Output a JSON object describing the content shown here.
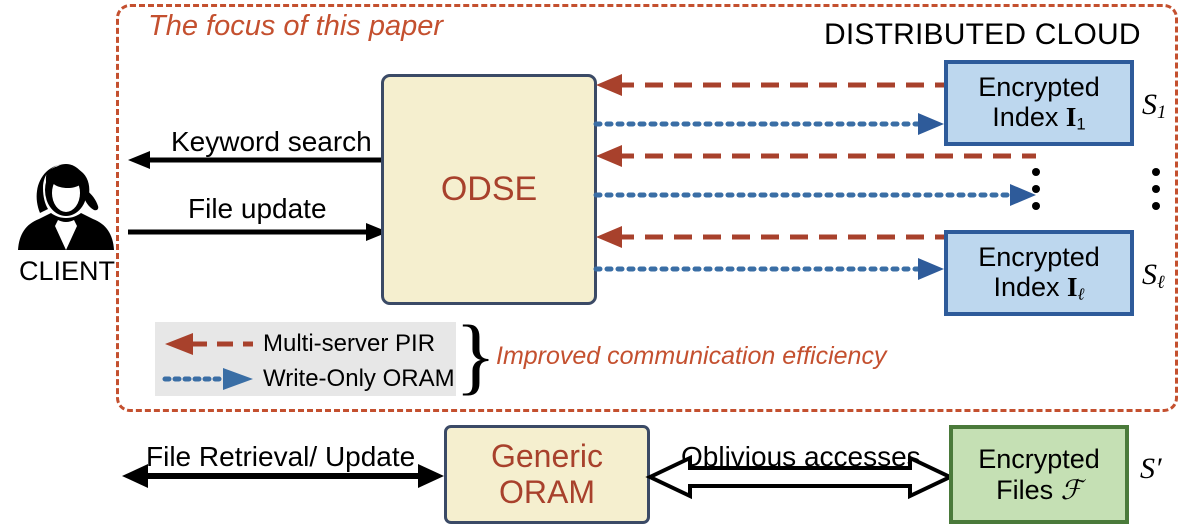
{
  "diagram": {
    "focus_label": "The focus of this paper",
    "cloud_label": "DISTRIBUTED CLOUD",
    "improved_label": "Improved communication efficiency",
    "brace_glyph": "}"
  },
  "client": {
    "label": "CLIENT",
    "icon": "user-silhouette-icon"
  },
  "odse": {
    "label": "ODSE"
  },
  "cloud_servers": [
    {
      "line1": "Encrypted",
      "line2_prefix": "Index ",
      "line2_symbol": "I",
      "line2_subscript": "1",
      "server_label_symbol": "S",
      "server_label_subscript": "1"
    },
    {
      "line1": "Encrypted",
      "line2_prefix": "Index ",
      "line2_symbol": "I",
      "line2_subscript": "ℓ",
      "server_label_symbol": "S",
      "server_label_subscript": "ℓ"
    }
  ],
  "flows": {
    "keyword_search": "Keyword search",
    "file_update": "File update",
    "file_retrieval_update": "File Retrieval/ Update",
    "oblivious_accesses": "Oblivious accesses"
  },
  "bottom": {
    "oram_line1": "Generic",
    "oram_line2": "ORAM",
    "files_line1": "Encrypted",
    "files_line2_prefix": "Files ",
    "files_line2_symbol": "ℱ",
    "files_server_label": "S′"
  },
  "legend": {
    "items": [
      {
        "label": "Multi-server PIR",
        "style": "dashed-left-arrow",
        "color": "#a8412c"
      },
      {
        "label": "Write-Only ORAM",
        "style": "dotted-right-arrow",
        "color": "#3a6ea5"
      }
    ]
  },
  "colors": {
    "accent_red": "#c4502f",
    "pir_red": "#a8412c",
    "oram_blue": "#3a6ea5",
    "cloud_box_fill": "#bdd7ee",
    "cloud_box_border": "#2e5b9a",
    "odse_fill": "#f5efcf",
    "odse_border": "#3b4a66",
    "files_fill": "#c5e0b4",
    "files_border": "#4a7a3a",
    "legend_fill": "#e7e7e7"
  }
}
